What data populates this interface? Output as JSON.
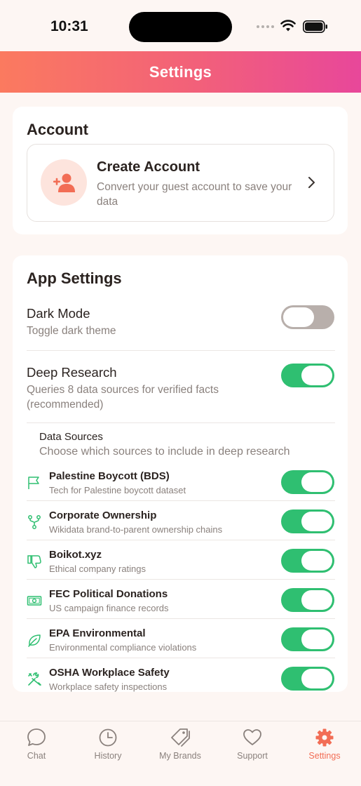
{
  "status_bar": {
    "time": "10:31"
  },
  "header": {
    "title": "Settings"
  },
  "account": {
    "title": "Account",
    "create_title": "Create Account",
    "create_desc": "Convert your guest account to save your data"
  },
  "app_settings": {
    "title": "App Settings",
    "dark_mode": {
      "label": "Dark Mode",
      "desc": "Toggle dark theme",
      "on": false
    },
    "deep_research": {
      "label": "Deep Research",
      "desc": "Queries 8 data sources for verified facts (recommended)",
      "on": true
    },
    "data_sources": {
      "label": "Data Sources",
      "desc": "Choose which sources to include in deep research",
      "items": [
        {
          "name": "Palestine Boycott (BDS)",
          "desc": "Tech for Palestine boycott dataset",
          "icon": "flag-icon",
          "on": true
        },
        {
          "name": "Corporate Ownership",
          "desc": "Wikidata brand-to-parent ownership chains",
          "icon": "git-fork-icon",
          "on": true
        },
        {
          "name": "Boikot.xyz",
          "desc": "Ethical company ratings",
          "icon": "thumbs-down-icon",
          "on": true
        },
        {
          "name": "FEC Political Donations",
          "desc": "US campaign finance records",
          "icon": "banknote-icon",
          "on": true
        },
        {
          "name": "EPA Environmental",
          "desc": "Environmental compliance violations",
          "icon": "leaf-icon",
          "on": true
        },
        {
          "name": "OSHA Workplace Safety",
          "desc": "Workplace safety inspections",
          "icon": "tools-icon",
          "on": true
        }
      ]
    }
  },
  "tabs": [
    {
      "label": "Chat",
      "icon": "chat-bubble-icon",
      "active": false
    },
    {
      "label": "History",
      "icon": "clock-icon",
      "active": false
    },
    {
      "label": "My Brands",
      "icon": "tags-icon",
      "active": false
    },
    {
      "label": "Support",
      "icon": "heart-icon",
      "active": false
    },
    {
      "label": "Settings",
      "icon": "gear-icon",
      "active": true
    }
  ],
  "colors": {
    "accent": "#f26d55",
    "toggle_on": "#2fbf71",
    "toggle_off": "#b8afab",
    "gradient_start": "#fb7a5f",
    "gradient_end": "#e8479a"
  }
}
